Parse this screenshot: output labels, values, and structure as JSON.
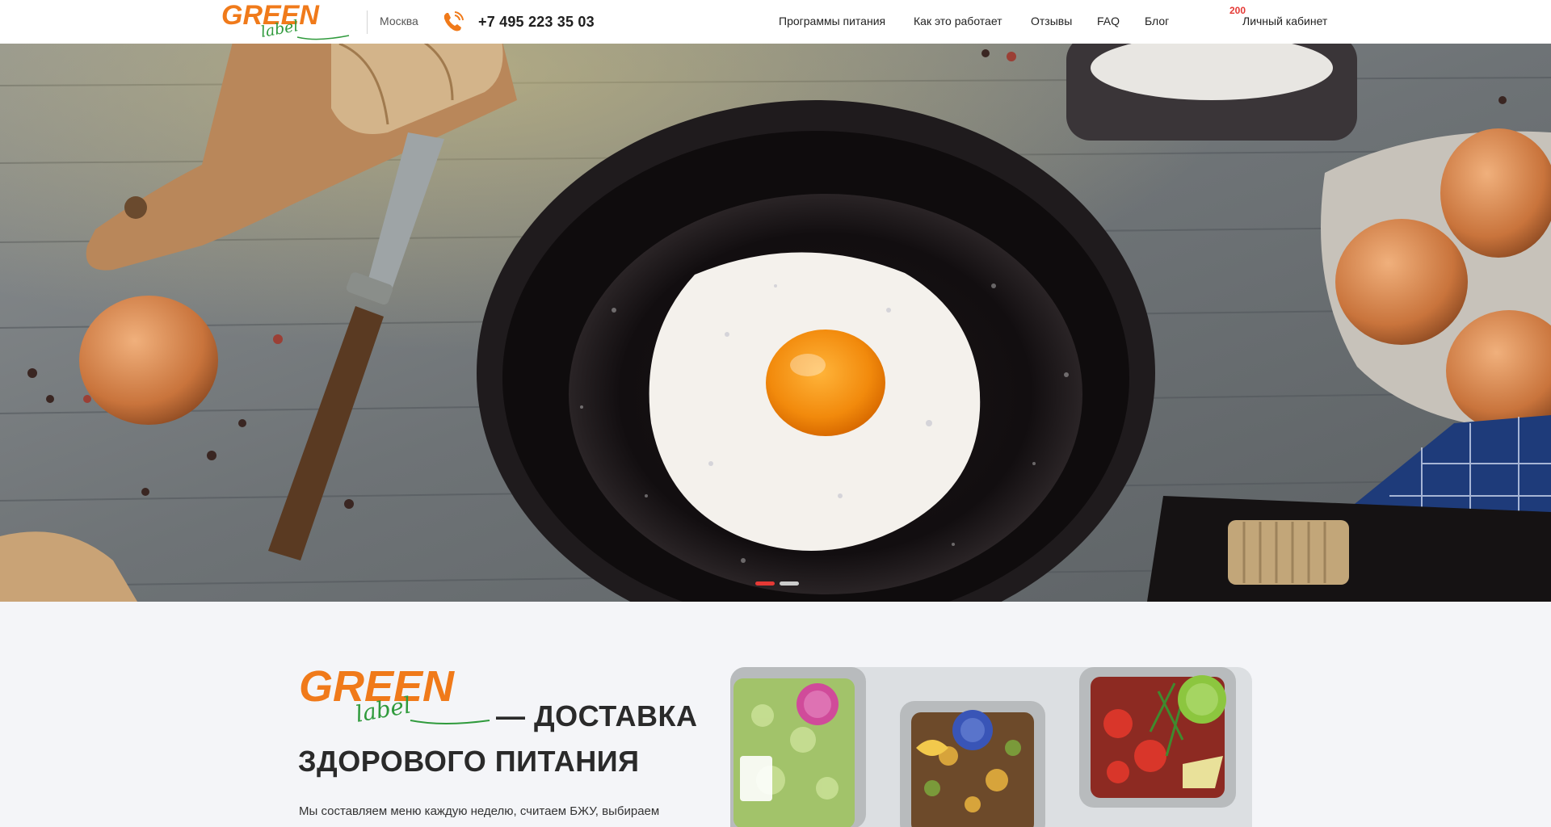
{
  "header": {
    "logo": {
      "word1": "GREEN",
      "word2": "label"
    },
    "city": "Москва",
    "phone": "+7 495 223 35 03",
    "nav": [
      "Программы питания",
      "Как это работает",
      "Отзывы",
      "FAQ",
      "Блог"
    ],
    "cart_count": "200",
    "account_label": "Личный кабинет"
  },
  "hero": {
    "slide_count": 2,
    "active_slide": 1
  },
  "intro": {
    "title_line1": "— ДОСТАВКА",
    "title_line2": "ЗДОРОВОГО ПИТАНИЯ",
    "text": "Мы составляем меню каждую неделю, считаем БЖУ, выбираем"
  },
  "colors": {
    "brand_orange": "#f07a1a",
    "brand_green": "#2f9a3c",
    "accent_red": "#e53935"
  }
}
